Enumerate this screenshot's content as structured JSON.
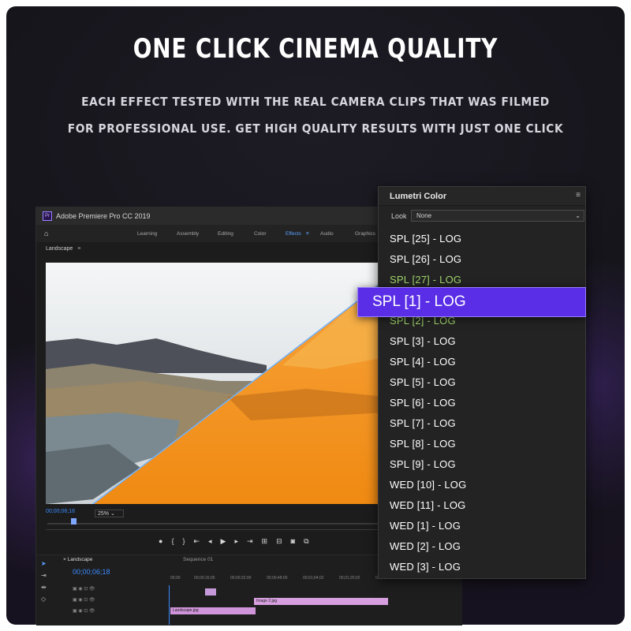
{
  "headline": "ONE CLICK CINEMA QUALITY",
  "subtitle_line1": "EACH EFFECT TESTED WITH THE REAL CAMERA CLIPS THAT WAS FILMED",
  "subtitle_line2": "FOR PROFESSIONAL USE. GET HIGH QUALITY RESULTS WITH JUST ONE CLICK",
  "premiere": {
    "logo": "Pr",
    "title": "Adobe Premiere Pro CC 2019",
    "workspaces": [
      "Learning",
      "Assembly",
      "Editing",
      "Color",
      "Effects",
      "Audio",
      "Graphics"
    ],
    "active_workspace": "Effects",
    "panel_label": "Landscape",
    "timecode": "00;00;06;18",
    "zoom": "25%",
    "timeline_tab": "Landscape",
    "timeline_tab2": "Sequence 01",
    "timeline_timecode": "00;00;06;18",
    "ruler": [
      "00;00",
      "00;00;16;00",
      "00;00;32;00",
      "00;00;48;00",
      "00;01;04;02",
      "00;01;20;02",
      "00;01;36;02"
    ],
    "clips": [
      "Image 2.jpg",
      "Landscape.jpg"
    ]
  },
  "lumetri": {
    "title": "Lumetri Color",
    "look_label": "Look",
    "look_value": "None",
    "items": [
      "SPL [25] - LOG",
      "SPL [26] - LOG",
      "SPL [27] - LOG",
      "SPL [2] - LOG",
      "SPL [3] - LOG",
      "SPL [4] - LOG",
      "SPL [5] - LOG",
      "SPL [6] - LOG",
      "SPL [7] - LOG",
      "SPL [8] - LOG",
      "SPL [9] - LOG",
      "WED [10] - LOG",
      "WED [11] - LOG",
      "WED [1] - LOG",
      "WED [2] - LOG",
      "WED [3] - LOG"
    ],
    "selected": "SPL [1] - LOG"
  },
  "colors": {
    "accent": "#5a2ee6",
    "timecode": "#3b8cff",
    "graded": "#f2901a"
  }
}
